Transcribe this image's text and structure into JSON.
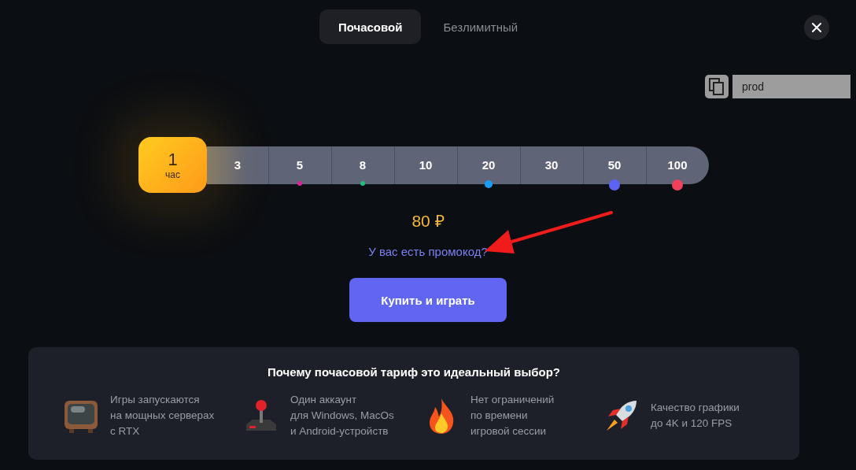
{
  "tabs": [
    {
      "label": "Почасовой",
      "selected": true
    },
    {
      "label": "Безлимитный",
      "selected": false
    }
  ],
  "promo_field": {
    "value": "prod"
  },
  "hours": [
    {
      "value": "1",
      "unit": "час",
      "selected": true
    },
    {
      "value": "3",
      "selected": false
    },
    {
      "value": "5",
      "selected": false,
      "dot": {
        "color": "#e0209a",
        "kind": "small"
      }
    },
    {
      "value": "8",
      "selected": false,
      "dot": {
        "color": "#1fc07a",
        "kind": "small"
      }
    },
    {
      "value": "10",
      "selected": false
    },
    {
      "value": "20",
      "selected": false,
      "dot": {
        "color": "#1a9cf5",
        "kind": "medium"
      }
    },
    {
      "value": "30",
      "selected": false
    },
    {
      "value": "50",
      "selected": false,
      "dot": {
        "color": "#5c64f5",
        "kind": "large"
      }
    },
    {
      "value": "100",
      "selected": false,
      "dot": {
        "color": "#f0405a",
        "kind": "large"
      }
    }
  ],
  "price": "80 ₽",
  "promo_link": "У вас есть промокод?",
  "buy_button": "Купить и играть",
  "benefits": {
    "title": "Почему почасовой тариф это идеальный выбор?",
    "items": [
      {
        "kind": "tv",
        "text": "Игры запускаются\nна мощных серверах\nс RTX"
      },
      {
        "kind": "joystick",
        "text": "Один аккаунт\nдля Windows, MacOs\nи Android-устройств"
      },
      {
        "kind": "fire",
        "text": "Нет ограничений\nпо времени\nигровой сессии"
      },
      {
        "kind": "rocket",
        "text": "Качество графики\nдо 4K и 120 FPS"
      }
    ]
  }
}
